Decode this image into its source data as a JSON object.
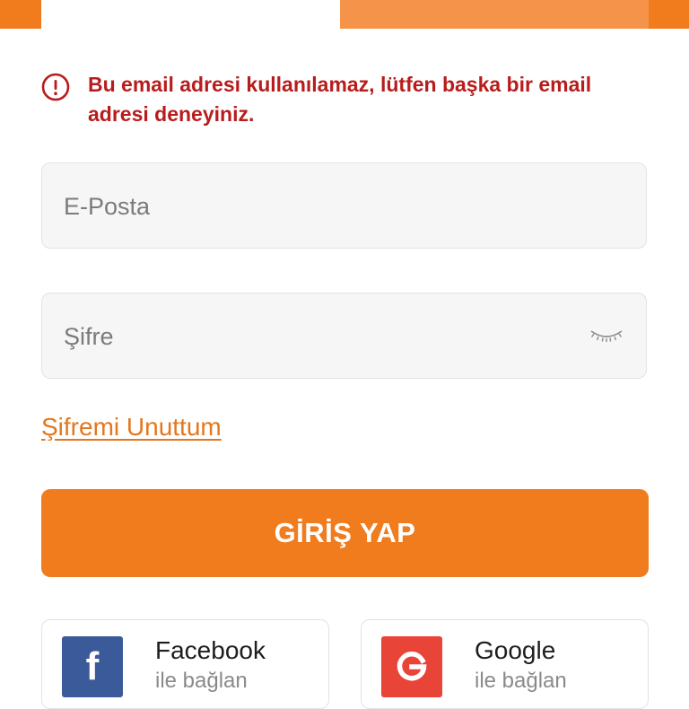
{
  "error": {
    "message": "Bu email adresi kullanılamaz, lütfen başka bir email adresi deneyiniz.",
    "icon": "exclamation-circle-icon",
    "color": "#b81c1c"
  },
  "email": {
    "placeholder": "E-Posta",
    "value": ""
  },
  "password": {
    "placeholder": "Şifre",
    "value": "",
    "toggle_icon": "eye-closed-icon"
  },
  "forgot_link": "Şifremi Unuttum",
  "login_button": "GİRİŞ YAP",
  "social": {
    "facebook": {
      "name": "Facebook",
      "sub": "ile bağlan",
      "icon": "facebook-icon",
      "color": "#3b5a99"
    },
    "google": {
      "name": "Google",
      "sub": "ile bağlan",
      "icon": "google-icon",
      "color": "#e84437"
    }
  },
  "colors": {
    "accent": "#f07c1e",
    "tab_light": "#f5934a"
  }
}
